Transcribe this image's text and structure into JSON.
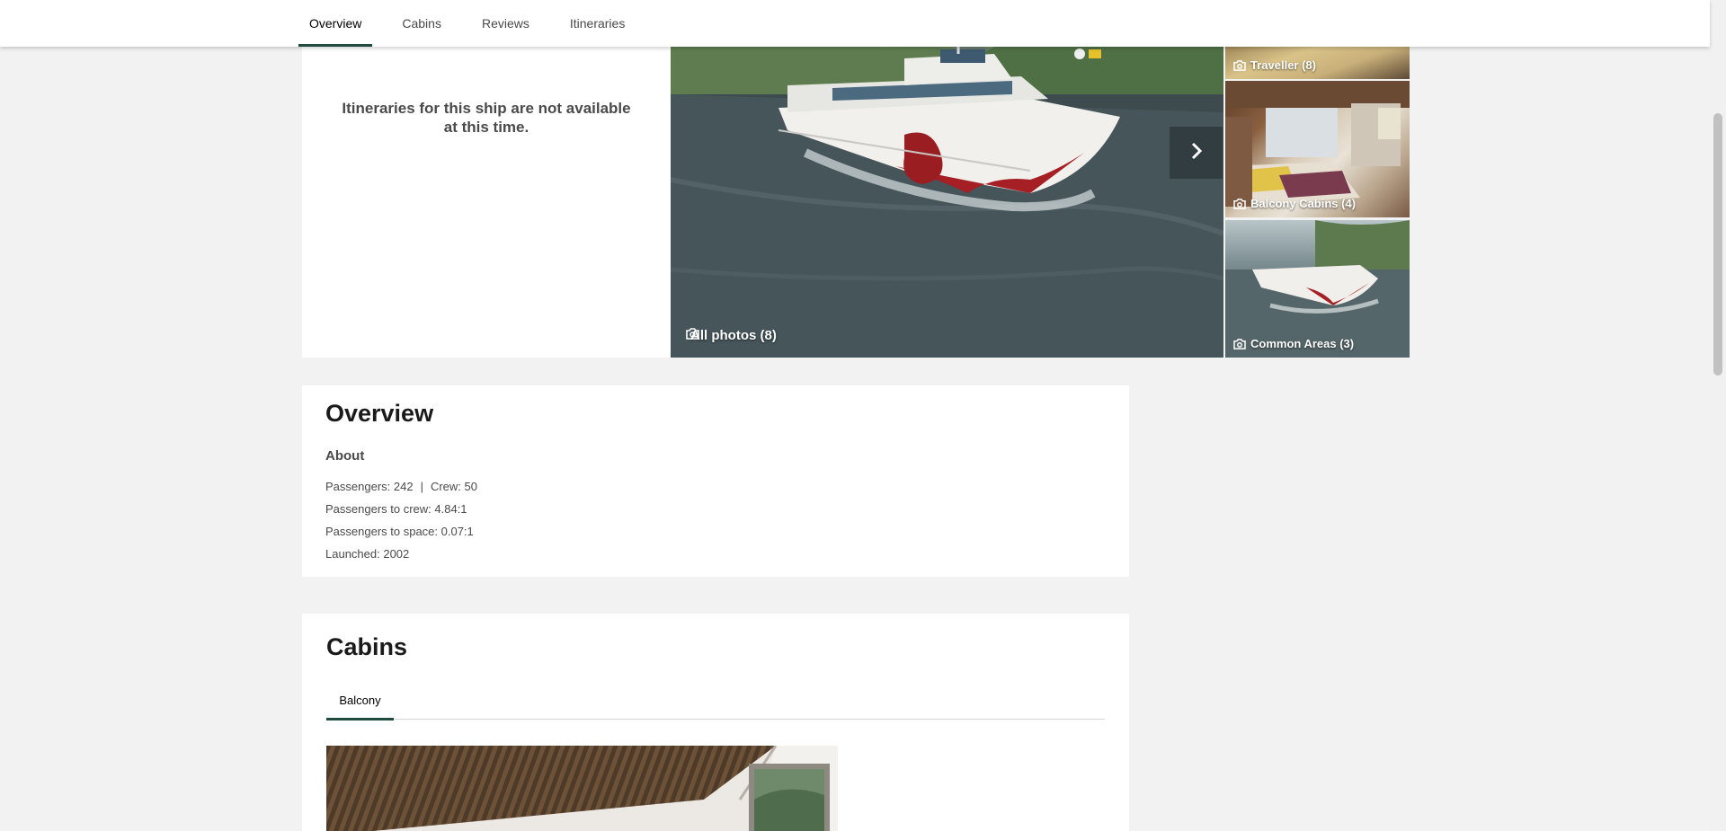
{
  "nav": {
    "tabs": [
      {
        "label": "Overview",
        "active": true
      },
      {
        "label": "Cabins",
        "active": false
      },
      {
        "label": "Reviews",
        "active": false
      },
      {
        "label": "Itineraries",
        "active": false
      }
    ]
  },
  "hero": {
    "no_itineraries_message": "Itineraries for this ship are not available at this time.",
    "main_photo_caption": "All photos (8)",
    "thumbnails": [
      {
        "caption": "Traveller (8)"
      },
      {
        "caption": "Balcony Cabins (4)"
      },
      {
        "caption": "Common Areas (3)"
      }
    ]
  },
  "overview": {
    "title": "Overview",
    "about_heading": "About",
    "passengers": "Passengers: 242",
    "separator": "|",
    "crew": "Crew: 50",
    "passengers_to_crew": "Passengers to crew: 4.84:1",
    "passengers_to_space": "Passengers to space: 0.07:1",
    "launched": "Launched: 2002"
  },
  "cabins": {
    "title": "Cabins",
    "tabs": [
      {
        "label": "Balcony",
        "active": true
      }
    ]
  },
  "colors": {
    "accent": "#1f4c3f",
    "page_bg": "#f2f2f2",
    "card_bg": "#ffffff"
  }
}
